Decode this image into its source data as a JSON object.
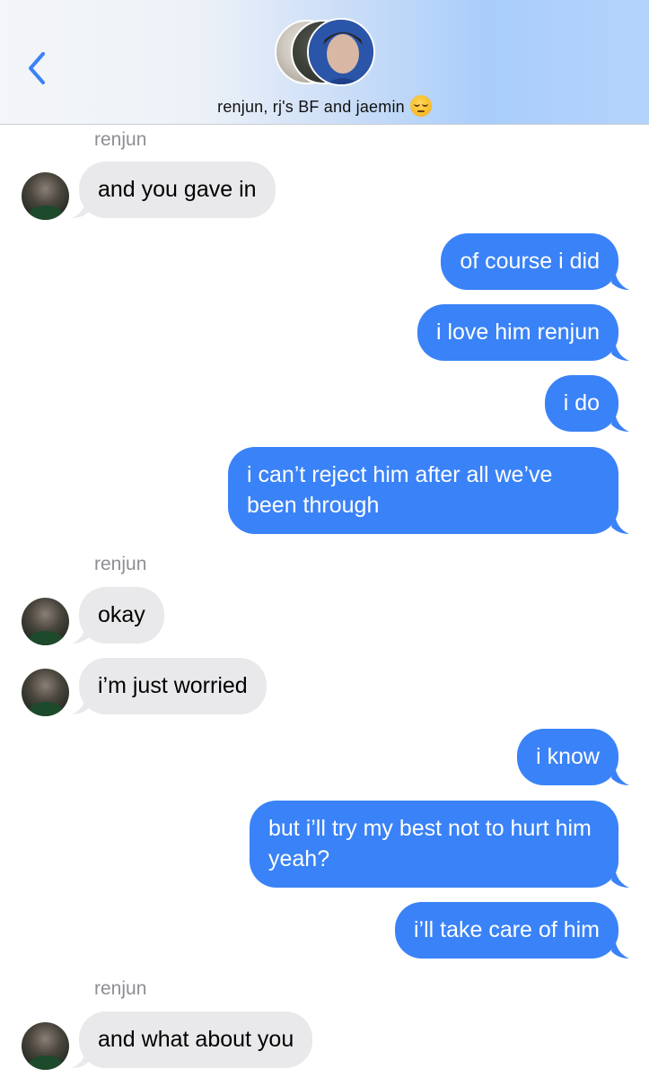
{
  "header": {
    "back_icon": "chevron-left-icon",
    "group_title": "renjun, rj's BF and jaemin",
    "title_emoji": "unamused-face-emoji",
    "accent_color": "#3a82f7"
  },
  "messages": [
    {
      "type": "name",
      "text": "renjun"
    },
    {
      "type": "in",
      "text": "and you gave in"
    },
    {
      "type": "out",
      "text": "of course i did"
    },
    {
      "type": "out",
      "text": "i love him renjun"
    },
    {
      "type": "out",
      "text": "i do"
    },
    {
      "type": "out",
      "text": "i can’t reject him after all we’ve been through"
    },
    {
      "type": "name",
      "text": "renjun"
    },
    {
      "type": "in",
      "text": "okay"
    },
    {
      "type": "in",
      "text": "i’m just worried"
    },
    {
      "type": "out",
      "text": "i know"
    },
    {
      "type": "out",
      "text": "but i’ll try my best not to hurt him yeah?"
    },
    {
      "type": "out",
      "text": "i’ll take care of him"
    },
    {
      "type": "name",
      "text": "renjun"
    },
    {
      "type": "in",
      "text": "and what about you"
    }
  ]
}
